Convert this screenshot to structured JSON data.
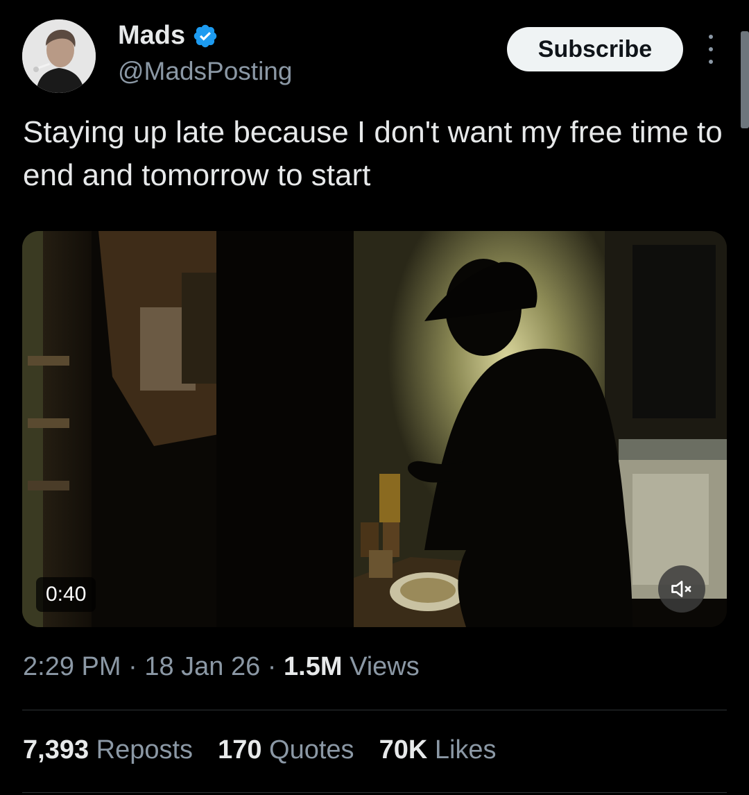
{
  "author": {
    "display_name": "Mads",
    "handle": "@MadsPosting",
    "verified": true
  },
  "header": {
    "subscribe_label": "Subscribe",
    "more_icon": "more-vertical-icon"
  },
  "tweet": {
    "text": "Staying up late because I don't want my free time to end and tomorrow to start"
  },
  "video": {
    "duration": "0:40",
    "muted": true,
    "mute_icon": "speaker-muted-icon"
  },
  "meta": {
    "time": "2:29 PM",
    "date": "18 Jan 26",
    "separator": "·",
    "views_count": "1.5M",
    "views_label": "Views"
  },
  "stats": {
    "reposts_count": "7,393",
    "reposts_label": "Reposts",
    "quotes_count": "170",
    "quotes_label": "Quotes",
    "likes_count": "70K",
    "likes_label": "Likes"
  },
  "colors": {
    "background": "#000000",
    "primary_text": "#e7e9ea",
    "secondary_text": "#8b98a5",
    "verified_badge": "#1d9bf0",
    "button_bg": "#eff3f4"
  }
}
